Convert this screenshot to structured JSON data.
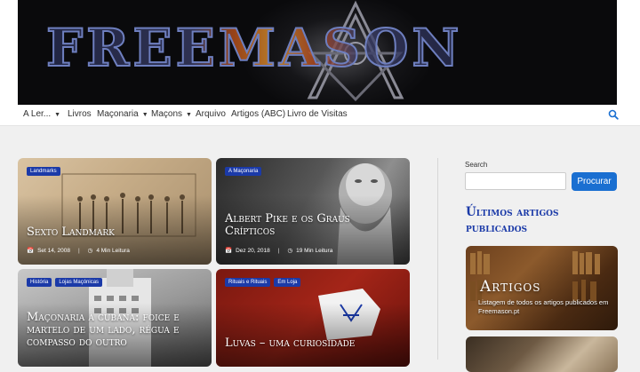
{
  "banner": {
    "title": "FREEMASON"
  },
  "nav": {
    "items": [
      {
        "label": "A Ler...",
        "dropdown": true
      },
      {
        "label": "Livros",
        "dropdown": false
      },
      {
        "label": "Maçonaria",
        "dropdown": true
      },
      {
        "label": "Maçons",
        "dropdown": true
      },
      {
        "label": "Arquivo",
        "dropdown": false
      },
      {
        "label": "Artigos (ABC)",
        "dropdown": false
      },
      {
        "label": "Livro de Visitas",
        "dropdown": false
      }
    ],
    "search_icon": "search-icon"
  },
  "posts": [
    {
      "tags": [
        "Landmarks"
      ],
      "title": "Sexto Landmark",
      "date": "Set 14, 2008",
      "read": "4 Min Leitura"
    },
    {
      "tags": [
        "A Maçonaria"
      ],
      "title": "Albert Pike e os Graus Crípticos",
      "date": "Dez 20, 2018",
      "read": "19 Min Leitura"
    },
    {
      "tags": [
        "História",
        "Lojas Maçónicas"
      ],
      "title": "Maçonaria à cubana: foice e martelo de um lado, régua e compasso do outro",
      "date": "",
      "read": ""
    },
    {
      "tags": [
        "Rituais e Rituais",
        "Em Loja"
      ],
      "title": "Luvas – uma curiosidade",
      "date": "",
      "read": ""
    }
  ],
  "sidebar": {
    "search_label": "Search",
    "search_placeholder": "",
    "search_button": "Procurar",
    "heading": "Últimos artigos publicados",
    "featured": {
      "title": "Artigos",
      "subtitle": "Listagem de todos os artigos publicados em Freemason.pt"
    }
  },
  "colors": {
    "accent": "#1b3aa8",
    "button": "#1a6fd1",
    "page_bg": "#f0f0f0"
  }
}
